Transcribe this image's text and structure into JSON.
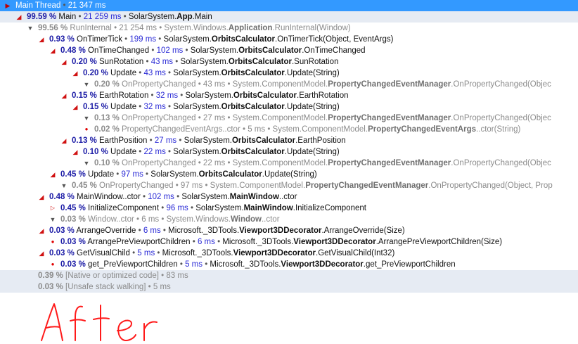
{
  "tree": [
    {
      "pct": "",
      "name": "Main Thread",
      "ms": "21 347 ms",
      "ns": "",
      "cls": "",
      "meth": "",
      "toggle": "flag",
      "kind": "sel",
      "indent": 0,
      "band": false
    },
    {
      "pct": "99.59 %",
      "name": "Main",
      "ms": "21 259 ms",
      "ns": "SolarSystem.",
      "cls": "App",
      "meth": ".Main",
      "toggle": "expanded",
      "kind": "normal",
      "indent": 1,
      "band": true
    },
    {
      "pct": "99.56 %",
      "name": "RunInternal",
      "ms": "21 254 ms",
      "ns": "System.Windows.",
      "cls": "Application",
      "meth": ".RunInternal(Window)",
      "toggle": "hidden",
      "kind": "dim",
      "indent": 2,
      "band": false
    },
    {
      "pct": "0.93 %",
      "name": "OnTimerTick",
      "ms": "199 ms",
      "ns": "SolarSystem.",
      "cls": "OrbitsCalculator",
      "meth": ".OnTimerTick(Object, EventArgs)",
      "toggle": "expanded",
      "kind": "normal",
      "indent": 3,
      "band": false
    },
    {
      "pct": "0.48 %",
      "name": "OnTimeChanged",
      "ms": "102 ms",
      "ns": "SolarSystem.",
      "cls": "OrbitsCalculator",
      "meth": ".OnTimeChanged",
      "toggle": "expanded",
      "kind": "normal",
      "indent": 4,
      "band": false
    },
    {
      "pct": "0.20 %",
      "name": "SunRotation",
      "ms": "43 ms",
      "ns": "SolarSystem.",
      "cls": "OrbitsCalculator",
      "meth": ".SunRotation",
      "toggle": "expanded",
      "kind": "normal",
      "indent": 5,
      "band": false
    },
    {
      "pct": "0.20 %",
      "name": "Update",
      "ms": "43 ms",
      "ns": "SolarSystem.",
      "cls": "OrbitsCalculator",
      "meth": ".Update(String)",
      "toggle": "expanded",
      "kind": "normal",
      "indent": 6,
      "band": false
    },
    {
      "pct": "0.20 %",
      "name": "OnPropertyChanged",
      "ms": "43 ms",
      "ns": "System.ComponentModel.",
      "cls": "PropertyChangedEventManager",
      "meth": ".OnPropertyChanged(Objec",
      "toggle": "hidden",
      "kind": "dim",
      "indent": 7,
      "band": false
    },
    {
      "pct": "0.15 %",
      "name": "EarthRotation",
      "ms": "32 ms",
      "ns": "SolarSystem.",
      "cls": "OrbitsCalculator",
      "meth": ".EarthRotation",
      "toggle": "expanded",
      "kind": "normal",
      "indent": 5,
      "band": false
    },
    {
      "pct": "0.15 %",
      "name": "Update",
      "ms": "32 ms",
      "ns": "SolarSystem.",
      "cls": "OrbitsCalculator",
      "meth": ".Update(String)",
      "toggle": "expanded",
      "kind": "normal",
      "indent": 6,
      "band": false
    },
    {
      "pct": "0.13 %",
      "name": "OnPropertyChanged",
      "ms": "27 ms",
      "ns": "System.ComponentModel.",
      "cls": "PropertyChangedEventManager",
      "meth": ".OnPropertyChanged(Objec",
      "toggle": "hidden",
      "kind": "dim",
      "indent": 7,
      "band": false
    },
    {
      "pct": "0.02 %",
      "name": "PropertyChangedEventArgs..ctor",
      "ms": "5 ms",
      "ns": "System.ComponentModel.",
      "cls": "PropertyChangedEventArgs",
      "meth": "..ctor(String)",
      "toggle": "leaf",
      "kind": "dim",
      "indent": 7,
      "band": false
    },
    {
      "pct": "0.13 %",
      "name": "EarthPosition",
      "ms": "27 ms",
      "ns": "SolarSystem.",
      "cls": "OrbitsCalculator",
      "meth": ".EarthPosition",
      "toggle": "expanded",
      "kind": "normal",
      "indent": 5,
      "band": false
    },
    {
      "pct": "0.10 %",
      "name": "Update",
      "ms": "22 ms",
      "ns": "SolarSystem.",
      "cls": "OrbitsCalculator",
      "meth": ".Update(String)",
      "toggle": "expanded",
      "kind": "normal",
      "indent": 6,
      "band": false
    },
    {
      "pct": "0.10 %",
      "name": "OnPropertyChanged",
      "ms": "22 ms",
      "ns": "System.ComponentModel.",
      "cls": "PropertyChangedEventManager",
      "meth": ".OnPropertyChanged(Objec",
      "toggle": "hidden",
      "kind": "dim",
      "indent": 7,
      "band": false
    },
    {
      "pct": "0.45 %",
      "name": "Update",
      "ms": "97 ms",
      "ns": "SolarSystem.",
      "cls": "OrbitsCalculator",
      "meth": ".Update(String)",
      "toggle": "expanded",
      "kind": "normal",
      "indent": 4,
      "band": false
    },
    {
      "pct": "0.45 %",
      "name": "OnPropertyChanged",
      "ms": "97 ms",
      "ns": "System.ComponentModel.",
      "cls": "PropertyChangedEventManager",
      "meth": ".OnPropertyChanged(Object, Prop",
      "toggle": "hidden",
      "kind": "dim",
      "indent": 5,
      "band": false
    },
    {
      "pct": "0.48 %",
      "name": "MainWindow..ctor",
      "ms": "102 ms",
      "ns": "SolarSystem.",
      "cls": "MainWindow",
      "meth": "..ctor",
      "toggle": "expanded",
      "kind": "normal",
      "indent": 3,
      "band": false
    },
    {
      "pct": "0.45 %",
      "name": "InitializeComponent",
      "ms": "96 ms",
      "ns": "SolarSystem.",
      "cls": "MainWindow",
      "meth": ".InitializeComponent",
      "toggle": "collapsed",
      "kind": "normal",
      "indent": 4,
      "band": false
    },
    {
      "pct": "0.03 %",
      "name": "Window..ctor",
      "ms": "6 ms",
      "ns": "System.Windows.",
      "cls": "Window",
      "meth": "..ctor",
      "toggle": "hidden",
      "kind": "dim",
      "indent": 4,
      "band": false
    },
    {
      "pct": "0.03 %",
      "name": "ArrangeOverride",
      "ms": "6 ms",
      "ns": "Microsoft._3DTools.",
      "cls": "Viewport3DDecorator",
      "meth": ".ArrangeOverride(Size)",
      "toggle": "expanded",
      "kind": "normal",
      "indent": 3,
      "band": false
    },
    {
      "pct": "0.03 %",
      "name": "ArrangePreViewportChildren",
      "ms": "6 ms",
      "ns": "Microsoft._3DTools.",
      "cls": "Viewport3DDecorator",
      "meth": ".ArrangePreViewportChildren(Size)",
      "toggle": "leaf",
      "kind": "normal",
      "indent": 4,
      "band": false
    },
    {
      "pct": "0.03 %",
      "name": "GetVisualChild",
      "ms": "5 ms",
      "ns": "Microsoft._3DTools.",
      "cls": "Viewport3DDecorator",
      "meth": ".GetVisualChild(Int32)",
      "toggle": "expanded",
      "kind": "normal",
      "indent": 3,
      "band": false
    },
    {
      "pct": "0.03 %",
      "name": "get_PreViewportChildren",
      "ms": "5 ms",
      "ns": "Microsoft._3DTools.",
      "cls": "Viewport3DDecorator",
      "meth": ".get_PreViewportChildren",
      "toggle": "leaf",
      "kind": "normal",
      "indent": 4,
      "band": false
    },
    {
      "pct": "0.39 %",
      "name": "[Native or optimized code]",
      "ms": "83 ms",
      "ns": "",
      "cls": "",
      "meth": "",
      "toggle": "none",
      "kind": "dim",
      "indent": 2,
      "band": true
    },
    {
      "pct": "0.03 %",
      "name": "[Unsafe stack walking]",
      "ms": "5 ms",
      "ns": "",
      "cls": "",
      "meth": "",
      "toggle": "none",
      "kind": "dim",
      "indent": 2,
      "band": true
    }
  ],
  "bullet": "•",
  "handwritten_note": "After",
  "colors": {
    "selection": "#3399ff",
    "band": "#e6ebf3",
    "percent": "#1c1ca6",
    "time": "#2b2bd6",
    "dim": "#8b8b8b",
    "note": "#ff1a1a"
  }
}
